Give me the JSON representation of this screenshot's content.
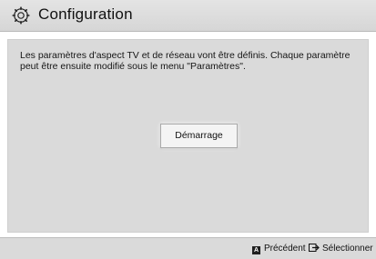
{
  "header": {
    "title": "Configuration",
    "icon": "gear-icon"
  },
  "main": {
    "message": "Les paramètres d'aspect TV et de réseau vont être définis. Chaque paramètre peut être ensuite modifié sous le menu \"Paramètres\".",
    "start_button_label": "Démarrage"
  },
  "footer": {
    "back_key": "A",
    "back_label": "Précédent",
    "select_label": "Sélectionner",
    "select_icon": "enter-icon"
  }
}
